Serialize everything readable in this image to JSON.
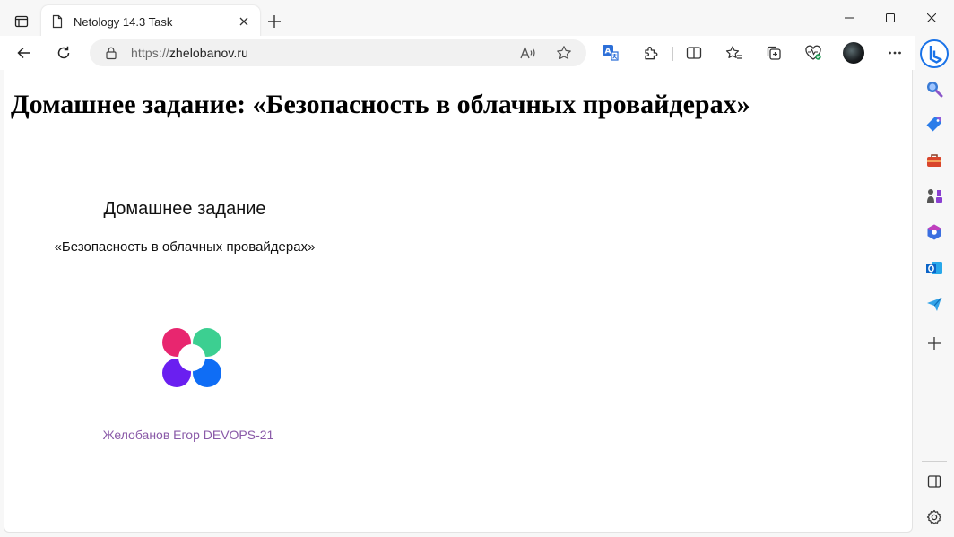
{
  "window": {
    "tab_title": "Netology 14.3 Task",
    "url_prefix": "https://",
    "url_host": "zhelobanov.ru"
  },
  "page": {
    "heading": "Домашнее задание: «Безопасность в облачных провайдерах»",
    "slide_title": "Домашнее задание",
    "slide_subtitle": "«Безопасность в облачных провайдерах»",
    "author": "Желобанов Егор DEVOPS-21"
  },
  "colors": {
    "logo_top_left": "#e8266f",
    "logo_top_right": "#3ccf91",
    "logo_bottom_left": "#6a1ff0",
    "logo_bottom_right": "#0f6df5",
    "author_text": "#8a5aa8"
  },
  "icons": {
    "toolbar": [
      "back-icon",
      "refresh-icon",
      "read-aloud-icon",
      "favorite-star-icon",
      "translate-icon",
      "extensions-icon",
      "split-screen-icon",
      "favorites-icon",
      "collections-icon",
      "browser-essentials-icon",
      "profile-avatar",
      "more-icon",
      "bing-copilot-icon"
    ],
    "sidebar": [
      "search-icon",
      "shopping-tag-icon",
      "tools-icon",
      "games-icon",
      "office-icon",
      "outlook-icon",
      "send-icon",
      "add-icon",
      "sidebar-toggle-icon",
      "settings-icon"
    ]
  }
}
